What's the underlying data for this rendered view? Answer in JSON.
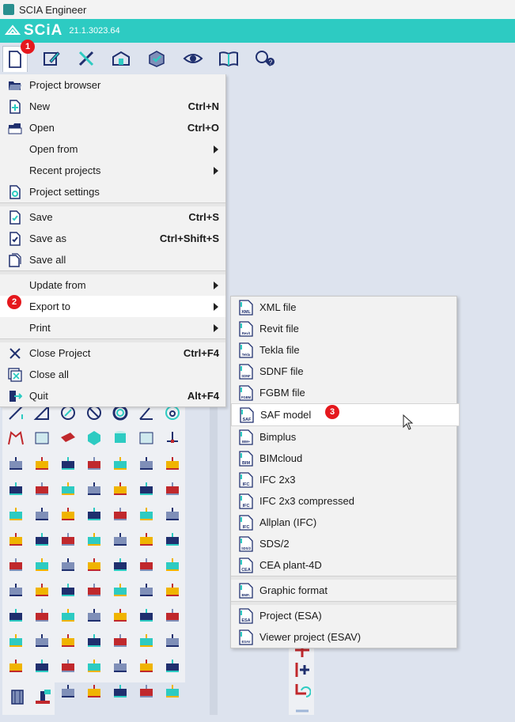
{
  "window": {
    "title": "SCIA Engineer"
  },
  "brand": {
    "logo": "SCiA",
    "version": "21.1.3023.64"
  },
  "toolbar": {
    "buttons": [
      {
        "name": "new-document-icon"
      },
      {
        "name": "edit-pencil-icon"
      },
      {
        "name": "tools-wrench-icon"
      },
      {
        "name": "structure-icon"
      },
      {
        "name": "check-icon"
      },
      {
        "name": "view-eye-icon"
      },
      {
        "name": "open-book-icon"
      },
      {
        "name": "help-search-icon"
      }
    ]
  },
  "badges": {
    "one": "1",
    "two": "2",
    "three": "3"
  },
  "file_menu": {
    "items": [
      {
        "label": "Project browser",
        "shortcut": "",
        "icon": "folder-open-icon"
      },
      {
        "label": "New",
        "shortcut": "Ctrl+N",
        "icon": "new-file-icon"
      },
      {
        "label": "Open",
        "shortcut": "Ctrl+O",
        "icon": "open-folder-icon"
      },
      {
        "label": "Open from",
        "shortcut": "",
        "icon": ""
      },
      {
        "label": "Recent projects",
        "shortcut": "",
        "icon": ""
      },
      {
        "label": "Project settings",
        "shortcut": "",
        "icon": "gear-file-icon"
      },
      {
        "label": "Save",
        "shortcut": "Ctrl+S",
        "icon": "save-icon"
      },
      {
        "label": "Save as",
        "shortcut": "Ctrl+Shift+S",
        "icon": "save-as-icon"
      },
      {
        "label": "Save all",
        "shortcut": "",
        "icon": "save-all-icon"
      },
      {
        "label": "Update from",
        "shortcut": "",
        "icon": ""
      },
      {
        "label": "Export to",
        "shortcut": "",
        "icon": ""
      },
      {
        "label": "Print",
        "shortcut": "",
        "icon": ""
      },
      {
        "label": "Close Project",
        "shortcut": "Ctrl+F4",
        "icon": "close-icon"
      },
      {
        "label": "Close all",
        "shortcut": "",
        "icon": "close-all-icon"
      },
      {
        "label": "Quit",
        "shortcut": "Alt+F4",
        "icon": "quit-icon"
      }
    ]
  },
  "export_menu": {
    "items": [
      {
        "label": "XML file",
        "tag": "XML"
      },
      {
        "label": "Revit file",
        "tag": "Revit"
      },
      {
        "label": "Tekla file",
        "tag": "Tekla"
      },
      {
        "label": "SDNF file",
        "tag": "SDNF"
      },
      {
        "label": "FGBM file",
        "tag": "FGBM"
      },
      {
        "label": "SAF model",
        "tag": "SAF"
      },
      {
        "label": "Bimplus",
        "tag": "BIM+"
      },
      {
        "label": "BIMcloud",
        "tag": "BIM"
      },
      {
        "label": "IFC 2x3",
        "tag": "IFC"
      },
      {
        "label": "IFC 2x3 compressed",
        "tag": "IFC"
      },
      {
        "label": "Allplan (IFC)",
        "tag": "IFC"
      },
      {
        "label": "SDS/2",
        "tag": "SDS/2"
      },
      {
        "label": "CEA plant-4D",
        "tag": "CEA"
      },
      {
        "label": "Graphic format",
        "tag": "BMP.."
      },
      {
        "label": "Project (ESA)",
        "tag": "ESA"
      },
      {
        "label": "Viewer project (ESAV)",
        "tag": "ESAV"
      }
    ]
  },
  "colors": {
    "accent": "#2dcbc2",
    "icon_blue": "#1f2f6e",
    "badge_red": "#e5181d",
    "icon_red": "#c0282c",
    "icon_yellow": "#f0b400"
  }
}
